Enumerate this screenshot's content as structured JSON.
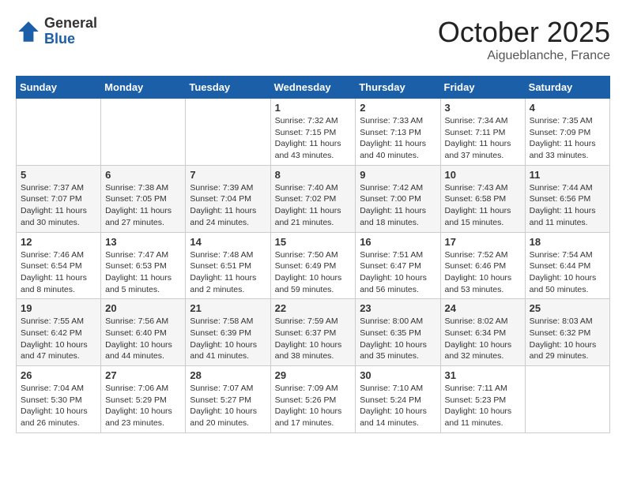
{
  "logo": {
    "general": "General",
    "blue": "Blue"
  },
  "header": {
    "month": "October 2025",
    "location": "Aigueblanche, France"
  },
  "weekdays": [
    "Sunday",
    "Monday",
    "Tuesday",
    "Wednesday",
    "Thursday",
    "Friday",
    "Saturday"
  ],
  "weeks": [
    [
      {
        "day": "",
        "info": ""
      },
      {
        "day": "",
        "info": ""
      },
      {
        "day": "",
        "info": ""
      },
      {
        "day": "1",
        "info": "Sunrise: 7:32 AM\nSunset: 7:15 PM\nDaylight: 11 hours\nand 43 minutes."
      },
      {
        "day": "2",
        "info": "Sunrise: 7:33 AM\nSunset: 7:13 PM\nDaylight: 11 hours\nand 40 minutes."
      },
      {
        "day": "3",
        "info": "Sunrise: 7:34 AM\nSunset: 7:11 PM\nDaylight: 11 hours\nand 37 minutes."
      },
      {
        "day": "4",
        "info": "Sunrise: 7:35 AM\nSunset: 7:09 PM\nDaylight: 11 hours\nand 33 minutes."
      }
    ],
    [
      {
        "day": "5",
        "info": "Sunrise: 7:37 AM\nSunset: 7:07 PM\nDaylight: 11 hours\nand 30 minutes."
      },
      {
        "day": "6",
        "info": "Sunrise: 7:38 AM\nSunset: 7:05 PM\nDaylight: 11 hours\nand 27 minutes."
      },
      {
        "day": "7",
        "info": "Sunrise: 7:39 AM\nSunset: 7:04 PM\nDaylight: 11 hours\nand 24 minutes."
      },
      {
        "day": "8",
        "info": "Sunrise: 7:40 AM\nSunset: 7:02 PM\nDaylight: 11 hours\nand 21 minutes."
      },
      {
        "day": "9",
        "info": "Sunrise: 7:42 AM\nSunset: 7:00 PM\nDaylight: 11 hours\nand 18 minutes."
      },
      {
        "day": "10",
        "info": "Sunrise: 7:43 AM\nSunset: 6:58 PM\nDaylight: 11 hours\nand 15 minutes."
      },
      {
        "day": "11",
        "info": "Sunrise: 7:44 AM\nSunset: 6:56 PM\nDaylight: 11 hours\nand 11 minutes."
      }
    ],
    [
      {
        "day": "12",
        "info": "Sunrise: 7:46 AM\nSunset: 6:54 PM\nDaylight: 11 hours\nand 8 minutes."
      },
      {
        "day": "13",
        "info": "Sunrise: 7:47 AM\nSunset: 6:53 PM\nDaylight: 11 hours\nand 5 minutes."
      },
      {
        "day": "14",
        "info": "Sunrise: 7:48 AM\nSunset: 6:51 PM\nDaylight: 11 hours\nand 2 minutes."
      },
      {
        "day": "15",
        "info": "Sunrise: 7:50 AM\nSunset: 6:49 PM\nDaylight: 10 hours\nand 59 minutes."
      },
      {
        "day": "16",
        "info": "Sunrise: 7:51 AM\nSunset: 6:47 PM\nDaylight: 10 hours\nand 56 minutes."
      },
      {
        "day": "17",
        "info": "Sunrise: 7:52 AM\nSunset: 6:46 PM\nDaylight: 10 hours\nand 53 minutes."
      },
      {
        "day": "18",
        "info": "Sunrise: 7:54 AM\nSunset: 6:44 PM\nDaylight: 10 hours\nand 50 minutes."
      }
    ],
    [
      {
        "day": "19",
        "info": "Sunrise: 7:55 AM\nSunset: 6:42 PM\nDaylight: 10 hours\nand 47 minutes."
      },
      {
        "day": "20",
        "info": "Sunrise: 7:56 AM\nSunset: 6:40 PM\nDaylight: 10 hours\nand 44 minutes."
      },
      {
        "day": "21",
        "info": "Sunrise: 7:58 AM\nSunset: 6:39 PM\nDaylight: 10 hours\nand 41 minutes."
      },
      {
        "day": "22",
        "info": "Sunrise: 7:59 AM\nSunset: 6:37 PM\nDaylight: 10 hours\nand 38 minutes."
      },
      {
        "day": "23",
        "info": "Sunrise: 8:00 AM\nSunset: 6:35 PM\nDaylight: 10 hours\nand 35 minutes."
      },
      {
        "day": "24",
        "info": "Sunrise: 8:02 AM\nSunset: 6:34 PM\nDaylight: 10 hours\nand 32 minutes."
      },
      {
        "day": "25",
        "info": "Sunrise: 8:03 AM\nSunset: 6:32 PM\nDaylight: 10 hours\nand 29 minutes."
      }
    ],
    [
      {
        "day": "26",
        "info": "Sunrise: 7:04 AM\nSunset: 5:30 PM\nDaylight: 10 hours\nand 26 minutes."
      },
      {
        "day": "27",
        "info": "Sunrise: 7:06 AM\nSunset: 5:29 PM\nDaylight: 10 hours\nand 23 minutes."
      },
      {
        "day": "28",
        "info": "Sunrise: 7:07 AM\nSunset: 5:27 PM\nDaylight: 10 hours\nand 20 minutes."
      },
      {
        "day": "29",
        "info": "Sunrise: 7:09 AM\nSunset: 5:26 PM\nDaylight: 10 hours\nand 17 minutes."
      },
      {
        "day": "30",
        "info": "Sunrise: 7:10 AM\nSunset: 5:24 PM\nDaylight: 10 hours\nand 14 minutes."
      },
      {
        "day": "31",
        "info": "Sunrise: 7:11 AM\nSunset: 5:23 PM\nDaylight: 10 hours\nand 11 minutes."
      },
      {
        "day": "",
        "info": ""
      }
    ]
  ]
}
